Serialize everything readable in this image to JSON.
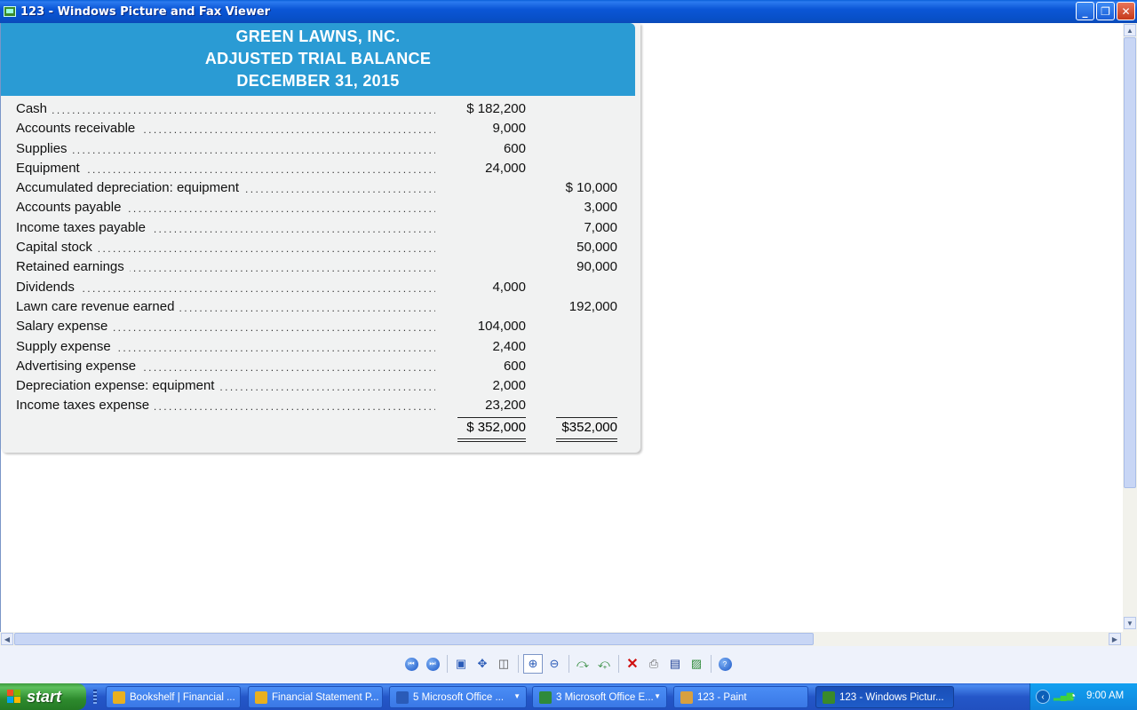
{
  "window": {
    "title": "123 - Windows Picture and Fax Viewer",
    "minimize": "_",
    "maximize": "❐",
    "close": "✕"
  },
  "document": {
    "company": "GREEN LAWNS, INC.",
    "report": "ADJUSTED TRIAL BALANCE",
    "date": "DECEMBER 31, 2015",
    "accounts": [
      {
        "name": "Cash",
        "debit": "$ 182,200",
        "credit": ""
      },
      {
        "name": "Accounts receivable",
        "debit": "9,000",
        "credit": ""
      },
      {
        "name": "Supplies",
        "debit": "600",
        "credit": ""
      },
      {
        "name": "Equipment",
        "debit": "24,000",
        "credit": ""
      },
      {
        "name": "Accumulated depreciation: equipment",
        "debit": "",
        "credit": "$ 10,000"
      },
      {
        "name": "Accounts payable",
        "debit": "",
        "credit": "3,000"
      },
      {
        "name": "Income taxes payable",
        "debit": "",
        "credit": "7,000"
      },
      {
        "name": "Capital stock",
        "debit": "",
        "credit": "50,000"
      },
      {
        "name": "Retained earnings",
        "debit": "",
        "credit": "90,000"
      },
      {
        "name": "Dividends",
        "debit": "4,000",
        "credit": ""
      },
      {
        "name": "Lawn care revenue earned",
        "debit": "",
        "credit": "192,000"
      },
      {
        "name": "Salary expense",
        "debit": "104,000",
        "credit": ""
      },
      {
        "name": "Supply expense",
        "debit": "2,400",
        "credit": ""
      },
      {
        "name": "Advertising expense",
        "debit": "600",
        "credit": ""
      },
      {
        "name": "Depreciation expense: equipment",
        "debit": "2,000",
        "credit": ""
      },
      {
        "name": "Income taxes expense",
        "debit": "23,200",
        "credit": ""
      }
    ],
    "total_debit": "$ 352,000",
    "total_credit": "$352,000"
  },
  "toolbar": {
    "icons": [
      "previous-image-icon",
      "next-image-icon",
      "best-fit-icon",
      "actual-size-icon",
      "slideshow-icon",
      "zoom-in-icon",
      "zoom-out-icon",
      "rotate-clockwise-icon",
      "rotate-counterclockwise-icon",
      "delete-icon",
      "print-icon",
      "save-icon",
      "open-editor-icon",
      "help-icon"
    ]
  },
  "taskbar": {
    "start": "start",
    "tasks": [
      {
        "label": "Bookshelf | Financial ...",
        "icon_color": "#e8b020"
      },
      {
        "label": "Financial Statement P...",
        "icon_color": "#e8b020"
      },
      {
        "label": "5 Microsoft Office ...",
        "icon_color": "#2a5bb8"
      },
      {
        "label": "3 Microsoft Office E...",
        "icon_color": "#2f8a3a"
      },
      {
        "label": "123 - Paint",
        "icon_color": "#d8a040"
      },
      {
        "label": "123 - Windows Pictur...",
        "icon_color": "#3a8a2a"
      }
    ],
    "clock": "9:00 AM"
  }
}
